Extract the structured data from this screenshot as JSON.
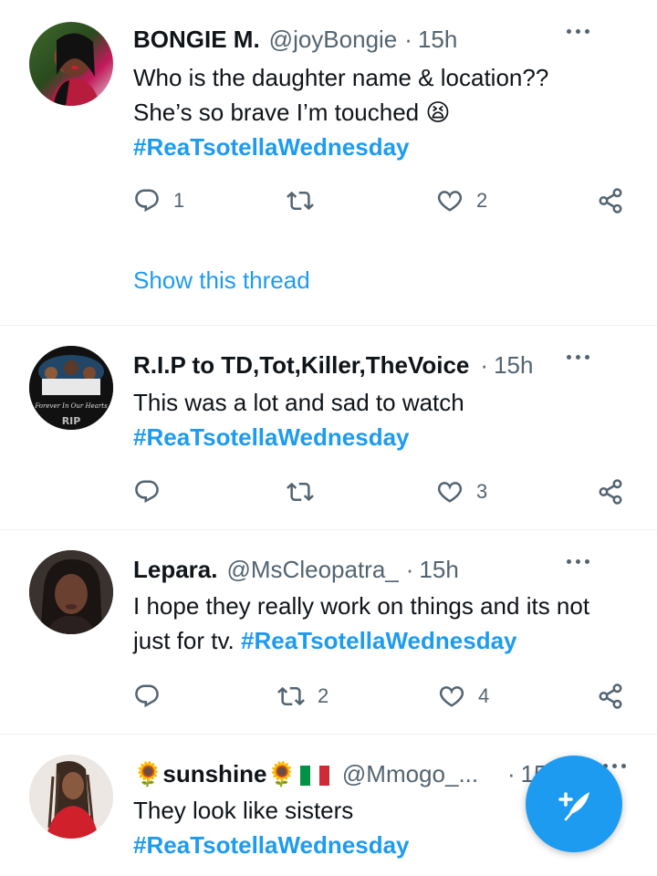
{
  "colors": {
    "accent": "#1d9bf0",
    "text": "#0f1419",
    "muted": "#536471",
    "divider": "#eff3f4"
  },
  "tweets": [
    {
      "name": "BONGIE M.",
      "handle": "@joyBongie",
      "dot": "·",
      "time": "15h",
      "text_lines": [
        "Who is the daughter name & location??",
        "She’s so brave I’m touched"
      ],
      "emoji": "😫",
      "hashtag": "#ReaTsotellaWednesday",
      "reply_count": "1",
      "retweet_count": "",
      "like_count": "2",
      "thread_link": "Show this thread"
    },
    {
      "name": "R.I.P to TD,Tot,Killer,TheVoice",
      "handle": "",
      "dot": "·",
      "time": "15h",
      "text_lines": [
        "This was a lot and sad to watch"
      ],
      "hashtag": "#ReaTsotellaWednesday",
      "reply_count": "",
      "retweet_count": "",
      "like_count": "3",
      "avatar_text": "RIP"
    },
    {
      "name": "Lepara.",
      "handle": "@MsCleopatra_",
      "dot": "·",
      "time": "15h",
      "text_lines": [
        "I hope they really work on things and its not",
        "just for tv."
      ],
      "hashtag": "#ReaTsotellaWednesday",
      "reply_count": "",
      "retweet_count": "2",
      "like_count": "4"
    },
    {
      "name": "sunshine",
      "name_prefix_emoji": "🌻",
      "name_suffix_emoji": "🌻",
      "flag": "italy-flag",
      "handle": "@Mmogo_...",
      "dot": "·",
      "time": "15",
      "text_lines": [
        "They look like sisters"
      ],
      "hashtag": "#ReaTsotellaWednesday"
    }
  ],
  "icons": {
    "reply": "reply-icon",
    "retweet": "retweet-icon",
    "like": "heart-icon",
    "share": "share-icon",
    "more": "more-icon",
    "compose": "compose-tweet-icon"
  }
}
